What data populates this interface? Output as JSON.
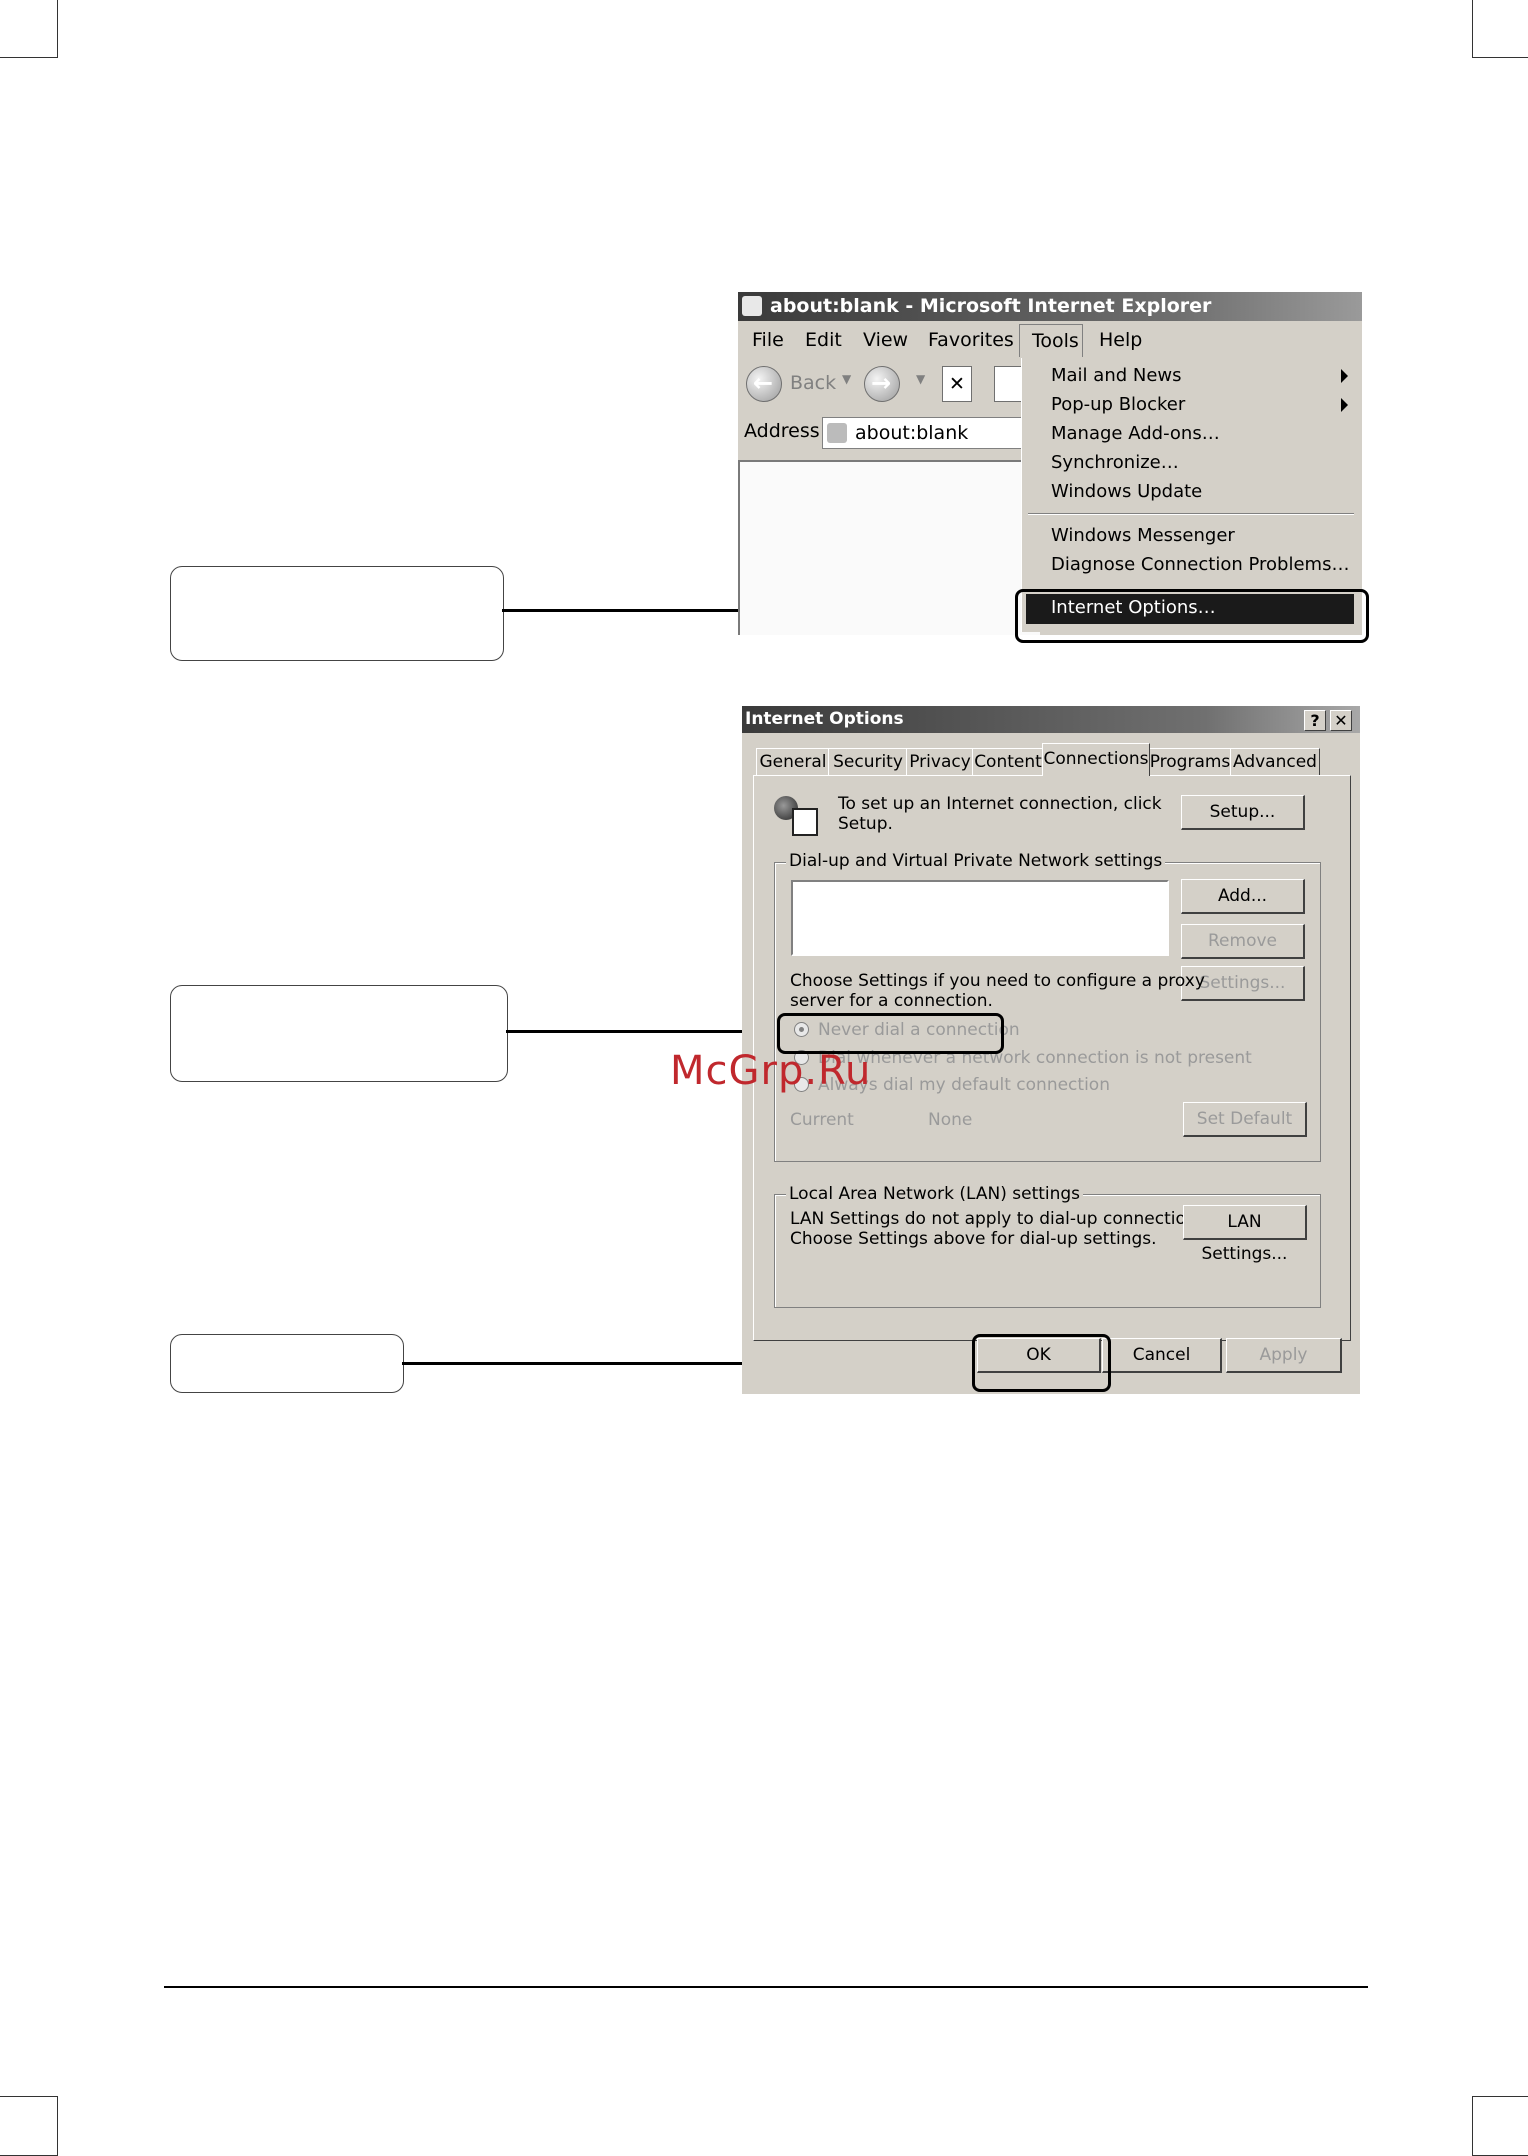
{
  "ie_window": {
    "title": "about:blank - Microsoft Internet Explorer",
    "menu": [
      "File",
      "Edit",
      "View",
      "Favorites",
      "Tools",
      "Help"
    ],
    "toolbar": {
      "back_label": "Back"
    },
    "address_label": "Address",
    "address_value": "about:blank"
  },
  "tools_menu": {
    "items": [
      "Mail and News",
      "Pop-up Blocker",
      "Manage Add-ons…",
      "Synchronize…",
      "Windows Update",
      "Windows Messenger",
      "Diagnose Connection Problems…"
    ],
    "highlighted": "Internet Options…"
  },
  "dialog": {
    "title": "Internet Options",
    "help_btn": "?",
    "close_btn": "✕",
    "tabs": [
      "General",
      "Security",
      "Privacy",
      "Content",
      "Connections",
      "Programs",
      "Advanced"
    ],
    "active_tab": "Connections",
    "setup_text_1": "To set up an Internet connection, click",
    "setup_text_2": "Setup.",
    "setup_button": "Setup...",
    "dialup_group": "Dial-up and Virtual Private Network settings",
    "add_button": "Add...",
    "remove_button": "Remove",
    "settings_button": "Settings...",
    "proxy_text_1": "Choose Settings if you need to configure a proxy",
    "proxy_text_2": "server for a connection.",
    "radio_never": "Never dial a connection",
    "radio_whenever": "Dial whenever a network connection is not present",
    "radio_always": "Always dial my default connection",
    "current_label": "Current",
    "current_value": "None",
    "set_default_button": "Set Default",
    "lan_group": "Local Area Network (LAN) settings",
    "lan_text_1": "LAN Settings do not apply to dial-up connections.",
    "lan_text_2": "Choose Settings above for dial-up settings.",
    "lan_button": "LAN Settings...",
    "ok_button": "OK",
    "cancel_button": "Cancel",
    "apply_button": "Apply"
  },
  "watermark": "McGrp.Ru"
}
